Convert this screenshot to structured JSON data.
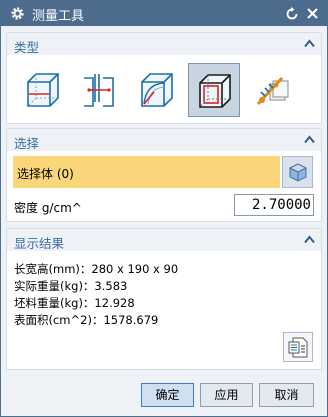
{
  "window": {
    "title": "测量工具",
    "title_icon": "gear-icon",
    "reset_icon": "reset-icon",
    "close_icon": "close-icon"
  },
  "type_section": {
    "header": "类型",
    "buttons": [
      {
        "icon": "cube-diagonal-icon"
      },
      {
        "icon": "section-cut-icon"
      },
      {
        "icon": "rounded-corner-icon"
      },
      {
        "icon": "bounding-box-icon",
        "selected": true
      },
      {
        "icon": "measure-brush-icon"
      }
    ]
  },
  "select_section": {
    "header": "选择",
    "select_body_label": "选择体 (0)",
    "select_body_icon": "cube-icon",
    "density_label": "密度 g/cm^",
    "density_value": "2.70000"
  },
  "results_section": {
    "header": "显示结果",
    "lines": [
      "长宽高(mm)：280 x 190 x 90",
      "实际重量(kg)：3.583",
      "坯料重量(kg)：12.928",
      "表面积(cm^2)：1578.679"
    ],
    "report_icon": "report-document-icon"
  },
  "footer": {
    "ok_label": "确定",
    "apply_label": "应用",
    "cancel_label": "取消"
  },
  "colors": {
    "titlebar": "#4c6b8d",
    "section_header_text": "#3a6da4",
    "selection_highlight": "#fad67b",
    "selected_button": "#c8d4e0"
  }
}
